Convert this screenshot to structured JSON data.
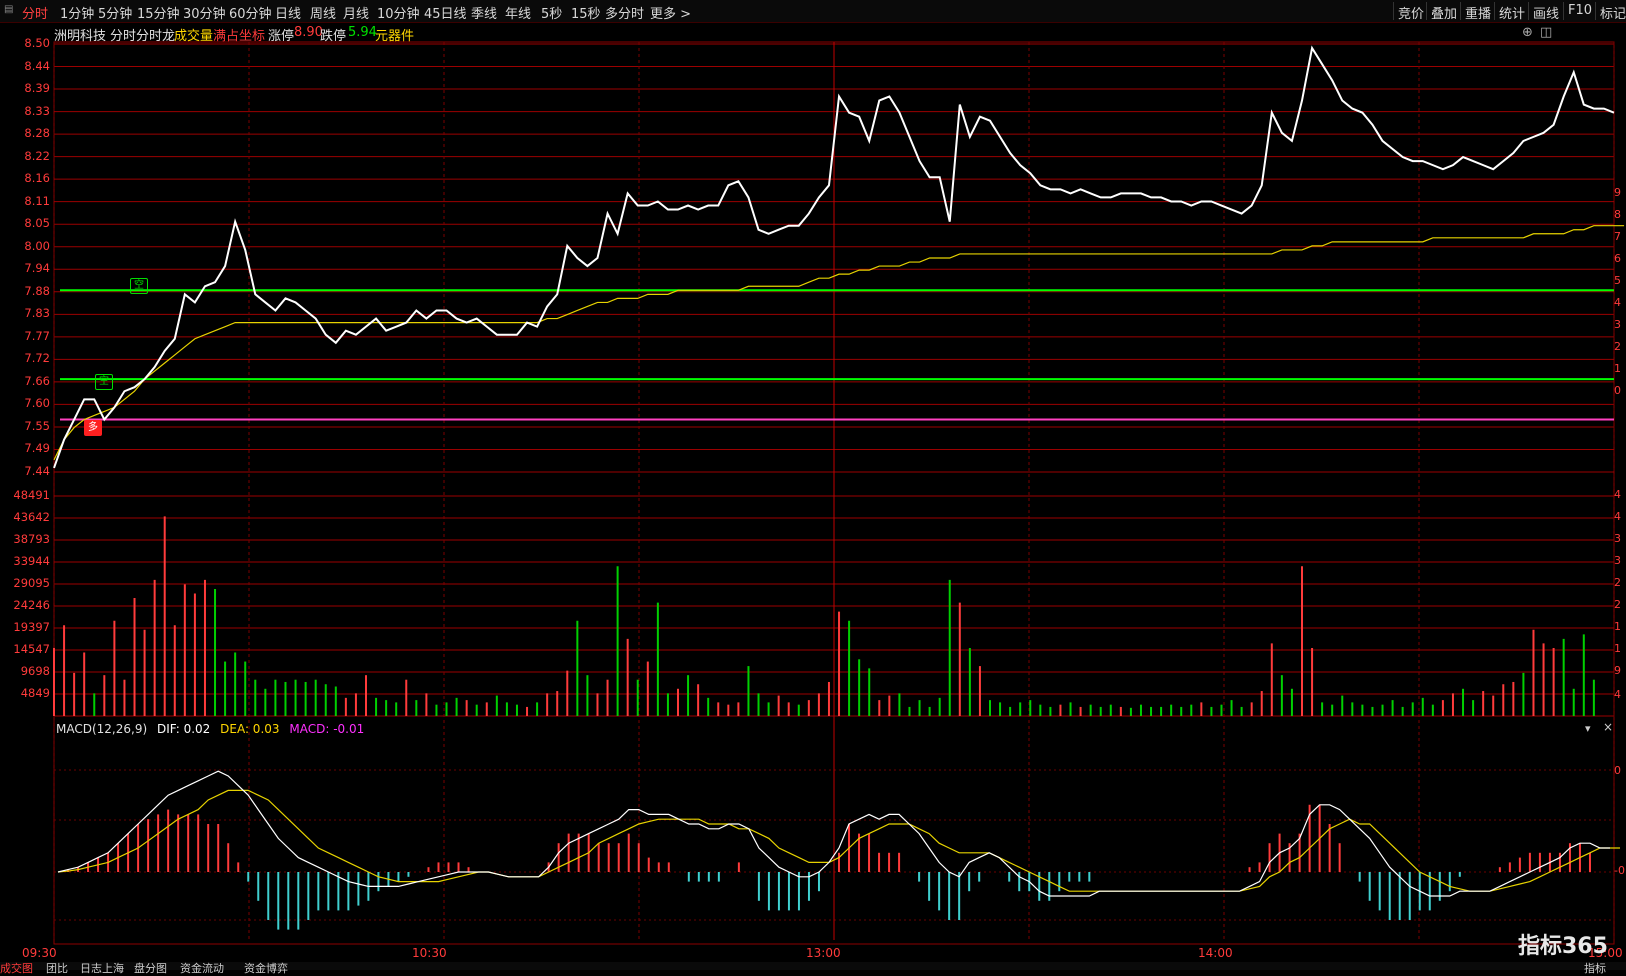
{
  "toolbar": {
    "timeframes": [
      "分时",
      "1分钟",
      "5分钟",
      "15分钟",
      "30分钟",
      "60分钟",
      "日线",
      "周线",
      "月线",
      "10分钟",
      "45日线",
      "季线",
      "年线",
      "5秒",
      "15秒",
      "多分时",
      "更多 >"
    ],
    "active": "分时",
    "right_buttons": [
      "竞价",
      "叠加",
      "重播",
      "统计",
      "画线",
      "F10",
      "标记"
    ]
  },
  "info": {
    "stock_name": "洲明科技",
    "mode1": "分时",
    "mode2": "分时龙",
    "volume_label": "成交量",
    "fullscreen_label": "满占坐标",
    "limit_up_label": "涨停",
    "limit_up_value": "8.90",
    "limit_down_label": "跌停",
    "limit_down_value": "5.94",
    "sector_label": "元器件"
  },
  "price_axis": [
    "8.50",
    "8.44",
    "8.39",
    "8.33",
    "8.28",
    "8.22",
    "8.16",
    "8.11",
    "8.05",
    "8.00",
    "7.94",
    "7.88",
    "7.83",
    "7.77",
    "7.72",
    "7.66",
    "7.60",
    "7.55",
    "7.49",
    "7.44"
  ],
  "volume_axis": [
    "48491",
    "43642",
    "38793",
    "33944",
    "29095",
    "24246",
    "19397",
    "14547",
    "9698",
    "4849"
  ],
  "right_axis": [
    "9",
    "8",
    "7",
    "6",
    "5",
    "4",
    "3",
    "2",
    "1",
    "0",
    "4",
    "4",
    "3",
    "3",
    "2",
    "2",
    "1",
    "1",
    "9",
    "4",
    "0",
    "-0"
  ],
  "time_axis": [
    "09:30",
    "10:30",
    "13:00",
    "14:00",
    "15:00"
  ],
  "macd": {
    "name": "MACD(12,26,9)",
    "dif_label": "DIF: 0.02",
    "dea_label": "DEA: 0.03",
    "macd_label": "MACD: -0.01"
  },
  "signals": [
    {
      "label": "空",
      "color": "#00e000"
    },
    {
      "label": "空",
      "color": "#00e000"
    },
    {
      "label": "多",
      "color": "#ff2020"
    }
  ],
  "bottom_tabs": [
    "成交图",
    "团比",
    "日志上海",
    "盘分图",
    "资金流动",
    "资金博弈"
  ],
  "bottom_right": "指标",
  "brand": "指标365",
  "chart_data": {
    "type": "line",
    "price_range": [
      7.44,
      8.5
    ],
    "volume_range": [
      0,
      48491
    ],
    "price": [
      7.45,
      7.52,
      7.57,
      7.62,
      7.62,
      7.57,
      7.6,
      7.64,
      7.65,
      7.67,
      7.7,
      7.74,
      7.77,
      7.88,
      7.86,
      7.9,
      7.91,
      7.95,
      8.06,
      7.99,
      7.88,
      7.86,
      7.84,
      7.87,
      7.86,
      7.84,
      7.82,
      7.78,
      7.76,
      7.79,
      7.78,
      7.8,
      7.82,
      7.79,
      7.8,
      7.81,
      7.84,
      7.82,
      7.84,
      7.84,
      7.82,
      7.81,
      7.82,
      7.8,
      7.78,
      7.78,
      7.78,
      7.81,
      7.8,
      7.85,
      7.88,
      8.0,
      7.97,
      7.95,
      7.97,
      8.08,
      8.03,
      8.13,
      8.1,
      8.1,
      8.11,
      8.09,
      8.09,
      8.1,
      8.09,
      8.1,
      8.1,
      8.15,
      8.16,
      8.12,
      8.04,
      8.03,
      8.04,
      8.05,
      8.05,
      8.08,
      8.12,
      8.15,
      8.37,
      8.33,
      8.32,
      8.26,
      8.36,
      8.37,
      8.33,
      8.27,
      8.21,
      8.17,
      8.17,
      8.06,
      8.35,
      8.27,
      8.32,
      8.31,
      8.27,
      8.23,
      8.2,
      8.18,
      8.15,
      8.14,
      8.14,
      8.13,
      8.14,
      8.13,
      8.12,
      8.12,
      8.13,
      8.13,
      8.13,
      8.12,
      8.12,
      8.11,
      8.11,
      8.1,
      8.11,
      8.11,
      8.1,
      8.09,
      8.08,
      8.1,
      8.15,
      8.33,
      8.28,
      8.26,
      8.36,
      8.49,
      8.45,
      8.41,
      8.36,
      8.34,
      8.33,
      8.3,
      8.26,
      8.24,
      8.22,
      8.21,
      8.21,
      8.2,
      8.19,
      8.2,
      8.22,
      8.21,
      8.2,
      8.19,
      8.21,
      8.23,
      8.26,
      8.27,
      8.28,
      8.3,
      8.37,
      8.43,
      8.35,
      8.34,
      8.34,
      8.33
    ],
    "avg_price": [
      7.47,
      7.52,
      7.55,
      7.57,
      7.58,
      7.59,
      7.6,
      7.62,
      7.64,
      7.67,
      7.69,
      7.71,
      7.73,
      7.75,
      7.77,
      7.78,
      7.79,
      7.8,
      7.81,
      7.81,
      7.81,
      7.81,
      7.81,
      7.81,
      7.81,
      7.81,
      7.81,
      7.81,
      7.81,
      7.81,
      7.81,
      7.81,
      7.81,
      7.81,
      7.81,
      7.81,
      7.81,
      7.81,
      7.81,
      7.81,
      7.81,
      7.81,
      7.81,
      7.81,
      7.81,
      7.81,
      7.81,
      7.81,
      7.81,
      7.82,
      7.82,
      7.83,
      7.84,
      7.85,
      7.86,
      7.86,
      7.87,
      7.87,
      7.87,
      7.88,
      7.88,
      7.88,
      7.89,
      7.89,
      7.89,
      7.89,
      7.89,
      7.89,
      7.89,
      7.9,
      7.9,
      7.9,
      7.9,
      7.9,
      7.9,
      7.91,
      7.92,
      7.92,
      7.93,
      7.93,
      7.94,
      7.94,
      7.95,
      7.95,
      7.95,
      7.96,
      7.96,
      7.97,
      7.97,
      7.97,
      7.98,
      7.98,
      7.98,
      7.98,
      7.98,
      7.98,
      7.98,
      7.98,
      7.98,
      7.98,
      7.98,
      7.98,
      7.98,
      7.98,
      7.98,
      7.98,
      7.98,
      7.98,
      7.98,
      7.98,
      7.98,
      7.98,
      7.98,
      7.98,
      7.98,
      7.98,
      7.98,
      7.98,
      7.98,
      7.98,
      7.98,
      7.98,
      7.99,
      7.99,
      7.99,
      8.0,
      8.0,
      8.01,
      8.01,
      8.01,
      8.01,
      8.01,
      8.01,
      8.01,
      8.01,
      8.01,
      8.01,
      8.02,
      8.02,
      8.02,
      8.02,
      8.02,
      8.02,
      8.02,
      8.02,
      8.02,
      8.02,
      8.03,
      8.03,
      8.03,
      8.03,
      8.04,
      8.04,
      8.05,
      8.05,
      8.05,
      8.05
    ],
    "support_lines": [
      7.89,
      7.67,
      7.57
    ],
    "volume": [
      15000,
      20000,
      9500,
      14000,
      5000,
      9000,
      21000,
      8000,
      26000,
      19000,
      30000,
      44000,
      20000,
      29000,
      27000,
      30000,
      28000,
      12000,
      14000,
      12000,
      8000,
      6000,
      8000,
      7500,
      8000,
      7500,
      8000,
      7000,
      6500,
      4000,
      5000,
      9000,
      4000,
      3500,
      3000,
      8000,
      3500,
      5000,
      2500,
      3000,
      4000,
      3500,
      2500,
      3000,
      4500,
      3000,
      2500,
      2000,
      3000,
      5000,
      5500,
      10000,
      21000,
      9000,
      5000,
      8000,
      33000,
      17000,
      8000,
      12000,
      25000,
      5000,
      6000,
      9000,
      7000,
      4000,
      3000,
      2500,
      3000,
      11000,
      5000,
      3000,
      4500,
      3000,
      2500,
      3500,
      5000,
      7500,
      23000,
      21000,
      12500,
      10500,
      3500,
      4500,
      5000,
      2000,
      3500,
      2000,
      4000,
      30000,
      25000,
      15000,
      11000,
      3500,
      3000,
      2000,
      3000,
      3500,
      2500,
      2000,
      2500,
      3000,
      2000,
      2500,
      2000,
      2500,
      2000,
      1800,
      2500,
      2000,
      2000,
      2500,
      2000,
      2500,
      3000,
      2000,
      2500,
      3500,
      2000,
      3000,
      5500,
      16000,
      9000,
      6000,
      33000,
      15000,
      3000,
      2500,
      4500,
      3000,
      2500,
      2000,
      2500,
      3500,
      2000,
      3000,
      4000,
      2500,
      3500,
      5000,
      6000,
      3500,
      5500,
      4500,
      7000,
      7500,
      9500,
      19000,
      16000,
      15000,
      17000,
      6000,
      18000,
      8000
    ],
    "volume_up": [
      1,
      1,
      1,
      1,
      0,
      1,
      1,
      1,
      1,
      1,
      1,
      1,
      1,
      1,
      1,
      1,
      0,
      0,
      0,
      0,
      0,
      0,
      0,
      0,
      0,
      0,
      0,
      0,
      0,
      1,
      1,
      1,
      0,
      0,
      0,
      1,
      0,
      1,
      0,
      0,
      0,
      1,
      0,
      1,
      0,
      0,
      0,
      1,
      0,
      1,
      1,
      1,
      0,
      0,
      1,
      1,
      0,
      1,
      0,
      1,
      0,
      0,
      1,
      0,
      1,
      0,
      1,
      1,
      1,
      0,
      0,
      0,
      1,
      1,
      0,
      1,
      1,
      1,
      1,
      0,
      0,
      0,
      1,
      1,
      0,
      0,
      0,
      0,
      0,
      0,
      1,
      0,
      1,
      0,
      0,
      0,
      0,
      0,
      0,
      0,
      1,
      0,
      1,
      0,
      0,
      0,
      1,
      0,
      0,
      0,
      0,
      0,
      0,
      0,
      1,
      0,
      0,
      0,
      0,
      1,
      1,
      1,
      0,
      0,
      1,
      1,
      0,
      0,
      0,
      0,
      0,
      0,
      0,
      0,
      0,
      0,
      0,
      0,
      1,
      1,
      0,
      0,
      1,
      1,
      1,
      1,
      0,
      1,
      1,
      1,
      0,
      0,
      0,
      0
    ],
    "macd_dif": [
      0.0,
      0.005,
      0.01,
      0.02,
      0.03,
      0.04,
      0.06,
      0.08,
      0.1,
      0.12,
      0.14,
      0.16,
      0.17,
      0.18,
      0.19,
      0.2,
      0.21,
      0.2,
      0.18,
      0.16,
      0.13,
      0.1,
      0.07,
      0.05,
      0.03,
      0.02,
      0.01,
      0.0,
      -0.01,
      -0.02,
      -0.025,
      -0.03,
      -0.03,
      -0.03,
      -0.03,
      -0.025,
      -0.02,
      -0.015,
      -0.01,
      -0.005,
      0.0,
      0.0,
      0.0,
      0.0,
      -0.005,
      -0.01,
      -0.01,
      -0.01,
      -0.01,
      0.01,
      0.04,
      0.06,
      0.07,
      0.08,
      0.09,
      0.1,
      0.11,
      0.13,
      0.13,
      0.12,
      0.12,
      0.12,
      0.11,
      0.1,
      0.1,
      0.09,
      0.09,
      0.1,
      0.1,
      0.09,
      0.05,
      0.03,
      0.01,
      0.0,
      -0.01,
      -0.01,
      0.0,
      0.02,
      0.05,
      0.1,
      0.11,
      0.12,
      0.11,
      0.12,
      0.12,
      0.1,
      0.08,
      0.05,
      0.02,
      0.0,
      -0.01,
      0.02,
      0.03,
      0.04,
      0.03,
      0.01,
      -0.01,
      -0.02,
      -0.04,
      -0.05,
      -0.05,
      -0.05,
      -0.05,
      -0.05,
      -0.04,
      -0.04,
      -0.04,
      -0.04,
      -0.04,
      -0.04,
      -0.04,
      -0.04,
      -0.04,
      -0.04,
      -0.04,
      -0.04,
      -0.04,
      -0.04,
      -0.04,
      -0.03,
      -0.02,
      0.02,
      0.04,
      0.05,
      0.07,
      0.12,
      0.14,
      0.14,
      0.13,
      0.11,
      0.09,
      0.07,
      0.04,
      0.01,
      -0.01,
      -0.03,
      -0.04,
      -0.05,
      -0.05,
      -0.05,
      -0.04,
      -0.04,
      -0.04,
      -0.04,
      -0.03,
      -0.02,
      -0.01,
      0.0,
      0.01,
      0.02,
      0.03,
      0.05,
      0.06,
      0.06,
      0.05,
      0.05
    ],
    "macd_dea": [
      0.0,
      0.002,
      0.005,
      0.01,
      0.015,
      0.02,
      0.03,
      0.04,
      0.05,
      0.065,
      0.08,
      0.095,
      0.11,
      0.12,
      0.13,
      0.15,
      0.16,
      0.17,
      0.17,
      0.17,
      0.16,
      0.15,
      0.13,
      0.11,
      0.09,
      0.07,
      0.05,
      0.04,
      0.03,
      0.02,
      0.01,
      0.0,
      -0.01,
      -0.015,
      -0.02,
      -0.02,
      -0.02,
      -0.02,
      -0.02,
      -0.015,
      -0.01,
      -0.005,
      0.0,
      0.0,
      -0.005,
      -0.01,
      -0.01,
      -0.01,
      -0.01,
      0.0,
      0.01,
      0.02,
      0.03,
      0.04,
      0.06,
      0.07,
      0.08,
      0.09,
      0.1,
      0.105,
      0.11,
      0.11,
      0.11,
      0.11,
      0.11,
      0.1,
      0.1,
      0.1,
      0.09,
      0.09,
      0.08,
      0.07,
      0.05,
      0.04,
      0.03,
      0.02,
      0.02,
      0.02,
      0.03,
      0.05,
      0.07,
      0.08,
      0.09,
      0.1,
      0.1,
      0.1,
      0.09,
      0.08,
      0.06,
      0.05,
      0.04,
      0.04,
      0.04,
      0.04,
      0.03,
      0.02,
      0.01,
      0.0,
      -0.01,
      -0.02,
      -0.03,
      -0.04,
      -0.04,
      -0.04,
      -0.04,
      -0.04,
      -0.04,
      -0.04,
      -0.04,
      -0.04,
      -0.04,
      -0.04,
      -0.04,
      -0.04,
      -0.04,
      -0.04,
      -0.04,
      -0.04,
      -0.04,
      -0.035,
      -0.03,
      -0.01,
      0.0,
      0.02,
      0.03,
      0.05,
      0.07,
      0.09,
      0.1,
      0.11,
      0.1,
      0.1,
      0.08,
      0.06,
      0.04,
      0.02,
      0.0,
      -0.01,
      -0.02,
      -0.03,
      -0.035,
      -0.04,
      -0.04,
      -0.04,
      -0.035,
      -0.03,
      -0.025,
      -0.02,
      -0.01,
      0.0,
      0.01,
      0.02,
      0.03,
      0.04,
      0.05,
      0.05,
      0.05
    ]
  }
}
